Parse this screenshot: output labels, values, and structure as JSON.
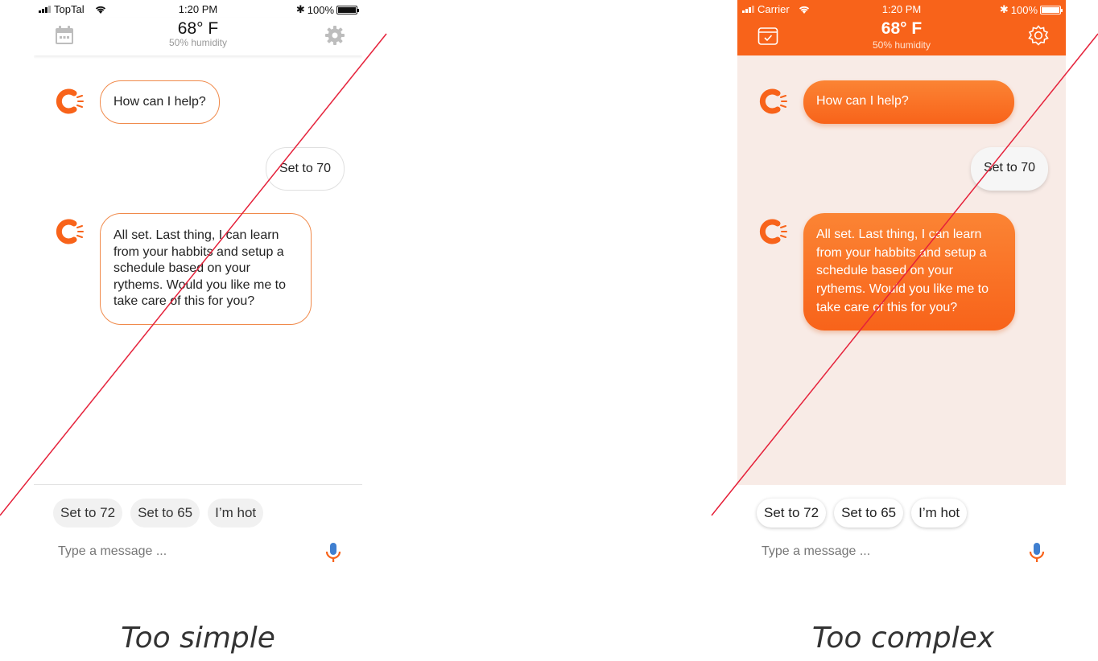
{
  "colors": {
    "accent": "#f8631a",
    "accent_light": "#fb8434",
    "complex_chat_bg": "#f8ebe6",
    "strike_line": "#e5213a",
    "mic_blue": "#3f7fd0"
  },
  "panels": {
    "simple": {
      "status_bar": {
        "carrier": "TopTal",
        "time": "1:20 PM",
        "battery": "100%"
      },
      "header": {
        "temperature": "68° F",
        "humidity": "50% humidity",
        "left_icon": "calendar-icon",
        "right_icon": "gear-icon"
      },
      "messages": {
        "bot_1": "How can I help?",
        "user_1": "Set to 70",
        "bot_2": "All set. Last thing, I can learn from your habbits and setup a schedule based on your rythems. Would you like me to take care of this for you?"
      },
      "quick_replies": [
        "Set to 72",
        "Set to 65",
        "I’m hot"
      ],
      "composer": {
        "placeholder": "Type a message ...",
        "icon": "microphone-icon"
      },
      "caption": "Too simple"
    },
    "complex": {
      "status_bar": {
        "carrier": "Carrier",
        "time": "1:20 PM",
        "battery": "100%"
      },
      "header": {
        "temperature": "68° F",
        "humidity": "50% humidity",
        "left_icon": "calendar-check-icon",
        "right_icon": "gear-icon"
      },
      "messages": {
        "bot_1": "How can I help?",
        "user_1": "Set to 70",
        "bot_2": "All set. Last thing, I can learn from your habbits and setup a schedule based on your rythems. Would you like me to take care of this for you?"
      },
      "quick_replies": [
        "Set to 72",
        "Set to 65",
        "I’m hot"
      ],
      "composer": {
        "placeholder": "Type a message ...",
        "icon": "microphone-icon"
      },
      "caption": "Too complex"
    }
  }
}
